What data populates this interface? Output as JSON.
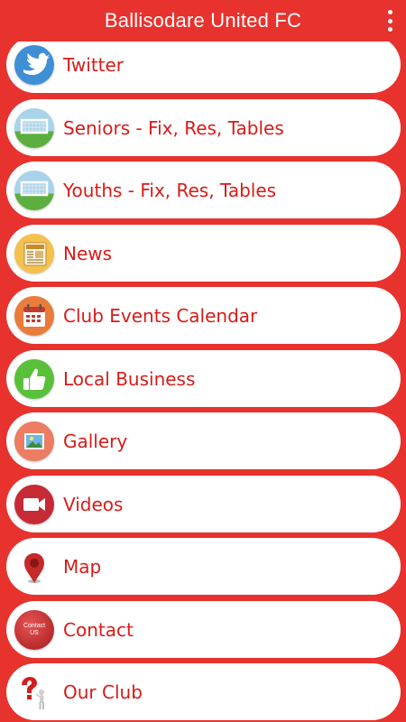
{
  "app": {
    "title": "Ballisodare United FC",
    "accent": "#e8322d",
    "label_color": "#d71b18",
    "menu_icon": "more-vertical-icon"
  },
  "menu": [
    {
      "label": "Twitter",
      "icon": "twitter-bird-icon"
    },
    {
      "label": "Seniors - Fix, Res, Tables",
      "icon": "football-goal-icon"
    },
    {
      "label": "Youths - Fix, Res, Tables",
      "icon": "football-goal-icon"
    },
    {
      "label": "News",
      "icon": "newspaper-icon"
    },
    {
      "label": "Club Events Calendar",
      "icon": "calendar-icon"
    },
    {
      "label": "Local Business",
      "icon": "thumbs-up-icon"
    },
    {
      "label": "Gallery",
      "icon": "picture-icon"
    },
    {
      "label": "Videos",
      "icon": "video-camera-icon"
    },
    {
      "label": "Map",
      "icon": "map-pin-icon"
    },
    {
      "label": "Contact",
      "icon": "contact-us-icon",
      "icon_text": "Contact US"
    },
    {
      "label": "Our Club",
      "icon": "question-person-icon"
    }
  ]
}
